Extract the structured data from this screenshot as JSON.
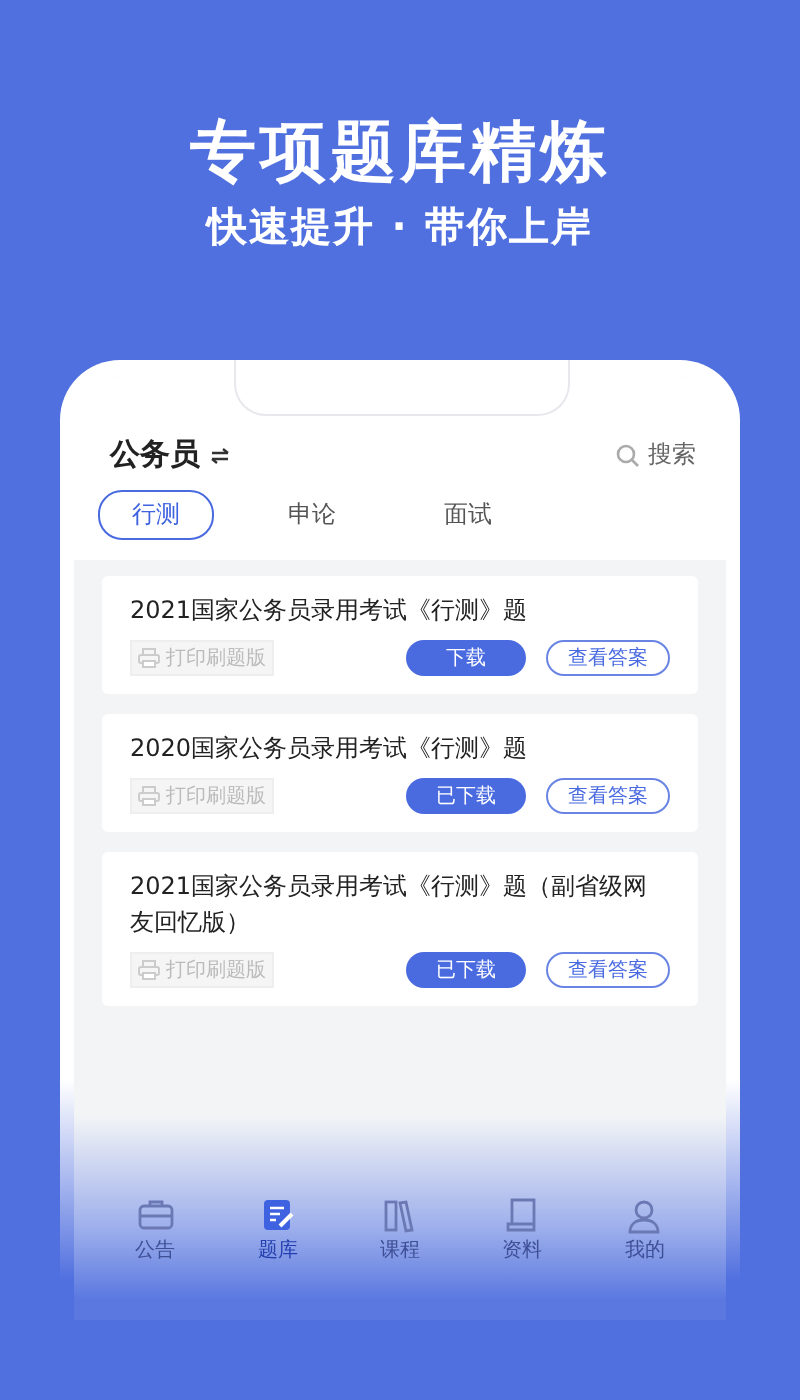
{
  "headline": "专项题库精炼",
  "subheadline": "快速提升 · 带你上岸",
  "header": {
    "title": "公务员",
    "search": "搜索"
  },
  "tabs": [
    {
      "label": "行测",
      "selected": true
    },
    {
      "label": "申论",
      "selected": false
    },
    {
      "label": "面试",
      "selected": false
    }
  ],
  "papers": [
    {
      "title": "2021国家公务员录用考试《行测》题",
      "print": "打印刷题版",
      "download": "下载",
      "answers": "查看答案"
    },
    {
      "title": "2020国家公务员录用考试《行测》题",
      "print": "打印刷题版",
      "download": "已下载",
      "answers": "查看答案"
    },
    {
      "title": "2021国家公务员录用考试《行测》题（副省级网友回忆版）",
      "print": "打印刷题版",
      "download": "已下载",
      "answers": "查看答案"
    }
  ],
  "nav": [
    {
      "label": "公告",
      "selected": false
    },
    {
      "label": "题库",
      "selected": true
    },
    {
      "label": "课程",
      "selected": false
    },
    {
      "label": "资料",
      "selected": false
    },
    {
      "label": "我的",
      "selected": false
    }
  ]
}
